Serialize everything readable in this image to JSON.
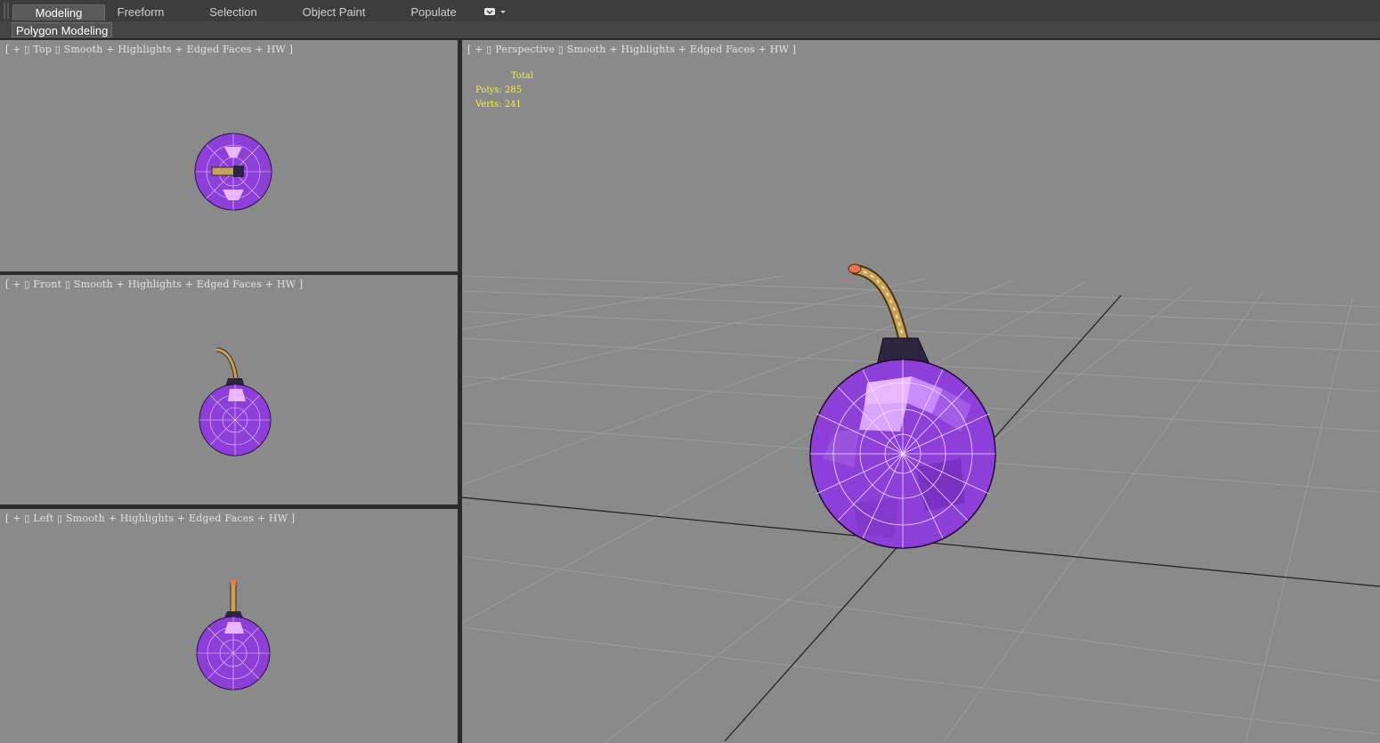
{
  "ribbon": {
    "tabs": [
      {
        "label": "Modeling",
        "active": true
      },
      {
        "label": "Freeform",
        "active": false
      },
      {
        "label": "Selection",
        "active": false
      },
      {
        "label": "Object Paint",
        "active": false
      },
      {
        "label": "Populate",
        "active": false
      }
    ],
    "more_icon": "dropdown-menu-icon",
    "panel_label": "Polygon Modeling"
  },
  "viewports": {
    "top": {
      "label": "[ + ▯ Top ▯ Smooth + Highlights + Edged Faces + HW ]"
    },
    "front": {
      "label": "[ + ▯ Front ▯ Smooth + Highlights + Edged Faces + HW ]"
    },
    "left": {
      "label": "[ + ▯ Left ▯ Smooth + Highlights + Edged Faces + HW ]"
    },
    "perspective": {
      "label": "[ + ▯ Perspective ▯ Smooth + Highlights + Edged Faces + HW ]"
    }
  },
  "stats": {
    "header": "Total",
    "polys": "Polys: 285",
    "verts": "Verts: 241"
  },
  "colors": {
    "viewport_bg": "#8a8a8a",
    "bomb_purple": "#8f3fd9",
    "bomb_highlight": "#e8b8ff",
    "fuse_gold": "#c8a25a",
    "stats_yellow": "#ffeb3b"
  }
}
